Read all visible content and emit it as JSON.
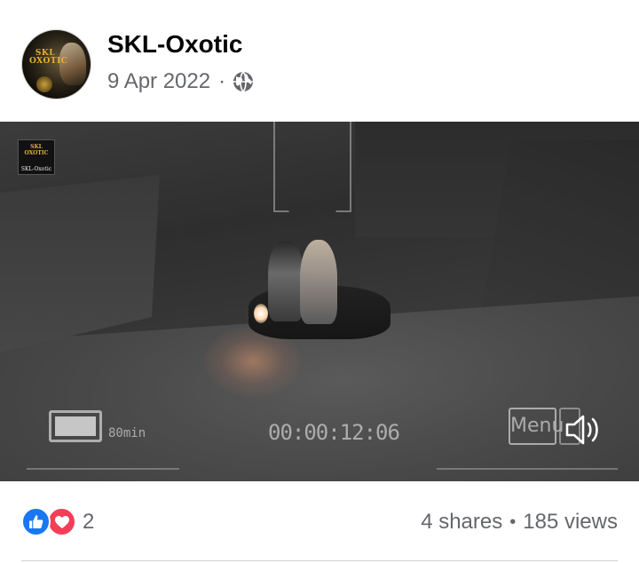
{
  "post": {
    "page_name": "SKL-Oxotic",
    "date": "9 Apr 2022",
    "separator": "·",
    "audience_icon": "globe-icon"
  },
  "avatar": {
    "logo_text": "SKL OXOTIC"
  },
  "video": {
    "watermark_logo": "SKL OXOTIC",
    "watermark_text": "SKL-Oxotic",
    "camera_overlay": {
      "battery_label": "80min",
      "timecode": "00:00:12:06",
      "menu_label": "Menu"
    },
    "volume_icon": "volume-on-icon"
  },
  "engagement": {
    "reactions": [
      "like",
      "love"
    ],
    "reaction_count": "2",
    "shares": "4 shares",
    "separator": "•",
    "views": "185 views"
  },
  "colors": {
    "like": "#1877f2",
    "love": "#f33e58",
    "secondary_text": "#65676b"
  }
}
